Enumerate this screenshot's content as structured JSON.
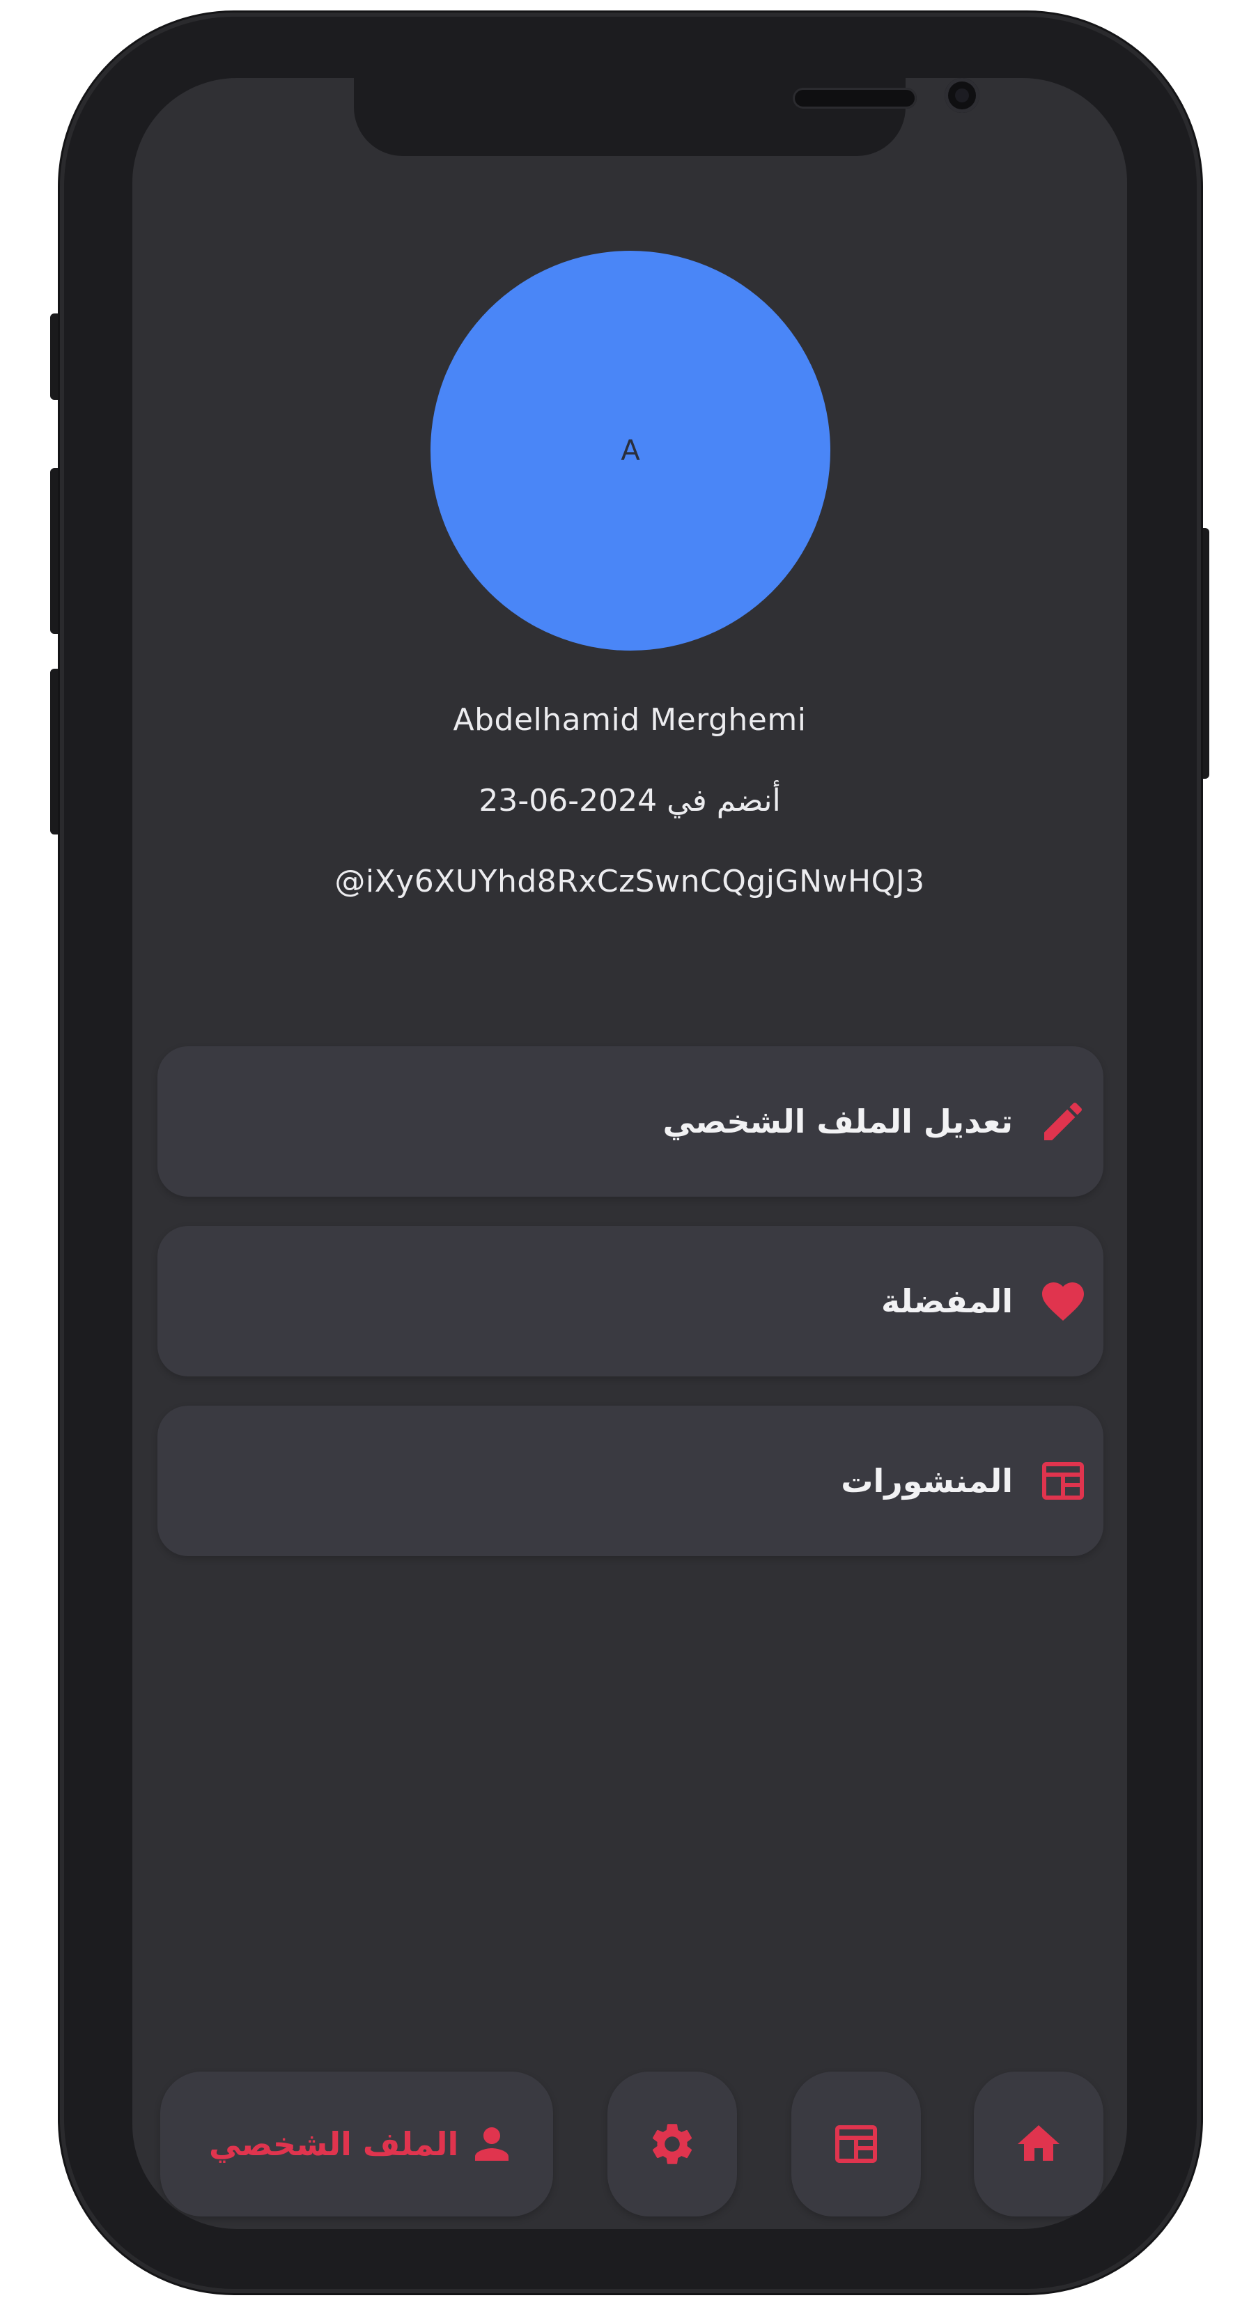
{
  "colors": {
    "accent": "#e0344e",
    "screen_bg": "#303034",
    "card_bg": "#3a3a41",
    "avatar_bg": "#4a86f7",
    "text": "#ececef"
  },
  "profile": {
    "avatar_initial": "A",
    "name": "Abdelhamid Merghemi",
    "joined": "أنضم في 2024-06-23",
    "handle": "@iXy6XUYhd8RxCzSwnCQgjGNwHQJ3"
  },
  "menu": {
    "items": [
      {
        "label": "تعديل الملف الشخصي",
        "icon": "pencil-icon"
      },
      {
        "label": "المفضلة",
        "icon": "heart-icon"
      },
      {
        "label": "المنشورات",
        "icon": "newspaper-icon"
      }
    ]
  },
  "bottom_nav": {
    "items": [
      {
        "label": "الملف الشخصي",
        "icon": "person-icon",
        "active": true
      },
      {
        "icon": "gear-icon"
      },
      {
        "icon": "newspaper-icon"
      },
      {
        "icon": "home-icon"
      }
    ]
  }
}
